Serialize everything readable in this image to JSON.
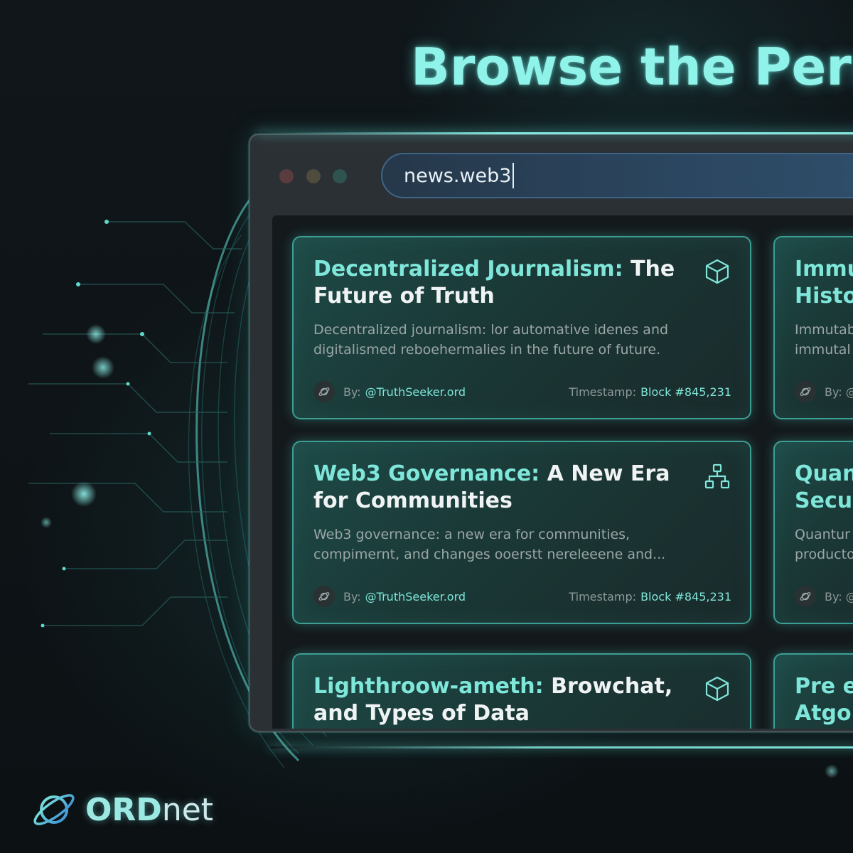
{
  "hero": {
    "title": "Browse the Perma"
  },
  "window": {
    "address": "news.web3"
  },
  "cards": [
    {
      "title_accent": "Decentralized Journalism:",
      "title_rest": " The Future of Truth",
      "desc": "Decentralized journalism: lor automative idenes and digitalismed reboehermalies in the future of future.",
      "icon": "cube-icon",
      "by_label": "By:",
      "author": "@TruthSeeker.ord",
      "ts_label": "Timestamp:",
      "block": "Block #845,231"
    },
    {
      "title_accent": "Web3 Governance:",
      "title_rest": " A New Era for Communities",
      "desc": "Web3 governance: a new era for communities, compimernt, and changes ooerstt nereleeene and...",
      "icon": "network-icon",
      "by_label": "By:",
      "author": "@TruthSeeker.ord",
      "ts_label": "Timestamp:",
      "block": "Block #845,231"
    },
    {
      "title_accent": "Lighthroow-ameth:",
      "title_rest": " Browchat, and Types of Data",
      "icon": "cube-icon"
    }
  ],
  "side_cards": [
    {
      "title": "Immu Histo",
      "desc": "Immutab immutal",
      "by_label": "By: @"
    },
    {
      "title": "Quan Secu",
      "desc": "Quantur producto",
      "by_label": "By: @"
    },
    {
      "title": "Pre e Atgor"
    }
  ],
  "brand": {
    "name_bold": "ORD",
    "name_rest": "net"
  },
  "colors": {
    "accent": "#7fe6da",
    "hero": "#8ff3ea",
    "card_border": "#3d9e93"
  }
}
